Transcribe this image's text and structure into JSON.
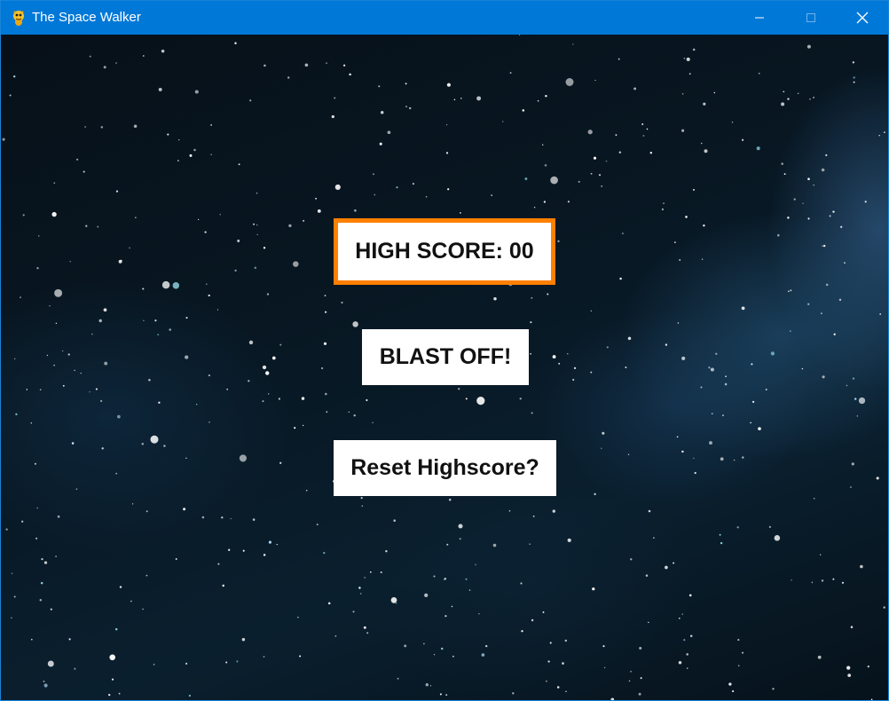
{
  "window": {
    "title": "The Space Walker",
    "app_icon": "python-snake-icon",
    "controls": [
      "minimize-icon",
      "maximize-icon",
      "close-icon"
    ]
  },
  "menu": {
    "highscore_label": "HIGH SCORE: 00",
    "start_label": "BLAST OFF!",
    "reset_label": "Reset Highscore?"
  },
  "colors": {
    "titlebar": "#0078d7",
    "highscore_border": "#ff7f00",
    "button_bg": "#ffffff",
    "button_text": "#111111",
    "space_bg": "#081824"
  }
}
